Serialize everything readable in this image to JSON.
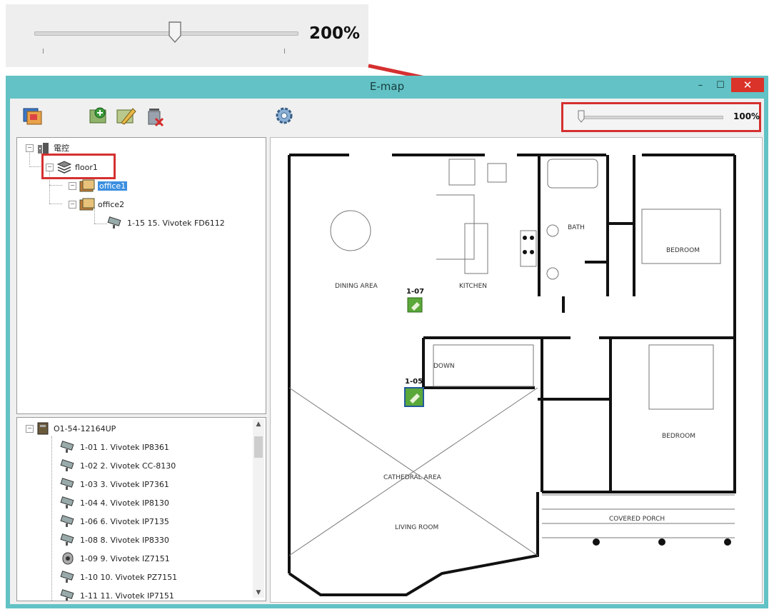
{
  "callout": {
    "zoom_label": "200%"
  },
  "window": {
    "title": "E-map",
    "minimize": "–",
    "maximize": "☐",
    "close": "✕"
  },
  "zoom": {
    "label": "100%"
  },
  "tree": {
    "root": "電控",
    "floor": "floor1",
    "office1": "office1",
    "office2": "office2",
    "camera": "1-15 15. Vivotek FD6112"
  },
  "devices": {
    "group": "O1-54-12164UP",
    "items": [
      "1-01 1. Vivotek IP8361",
      "1-02 2. Vivotek CC-8130",
      "1-03 3. Vivotek IP7361",
      "1-04 4. Vivotek IP8130",
      "1-06 6. Vivotek IP7135",
      "1-08 8. Vivotek IP8330",
      "1-09 9. Vivotek IZ7151",
      "1-10 10. Vivotek PZ7151",
      "1-11 11. Vivotek IP7151"
    ]
  },
  "map": {
    "rooms": {
      "dining": "DINING AREA",
      "kitchen": "KITCHEN",
      "bath": "BATH",
      "bedroom1": "BEDROOM",
      "bedroom2": "BEDROOM",
      "down": "DOWN",
      "cathedral": "CATHEDRAL AREA",
      "living": "LIVING ROOM",
      "porch": "COVERED PORCH"
    },
    "markers": {
      "m1": "1-07",
      "m2": "1-05"
    }
  },
  "colors": {
    "window": "#62c2c5",
    "highlight": "#d53030",
    "selection": "#3b8fe0",
    "marker": "#5aa83a"
  }
}
